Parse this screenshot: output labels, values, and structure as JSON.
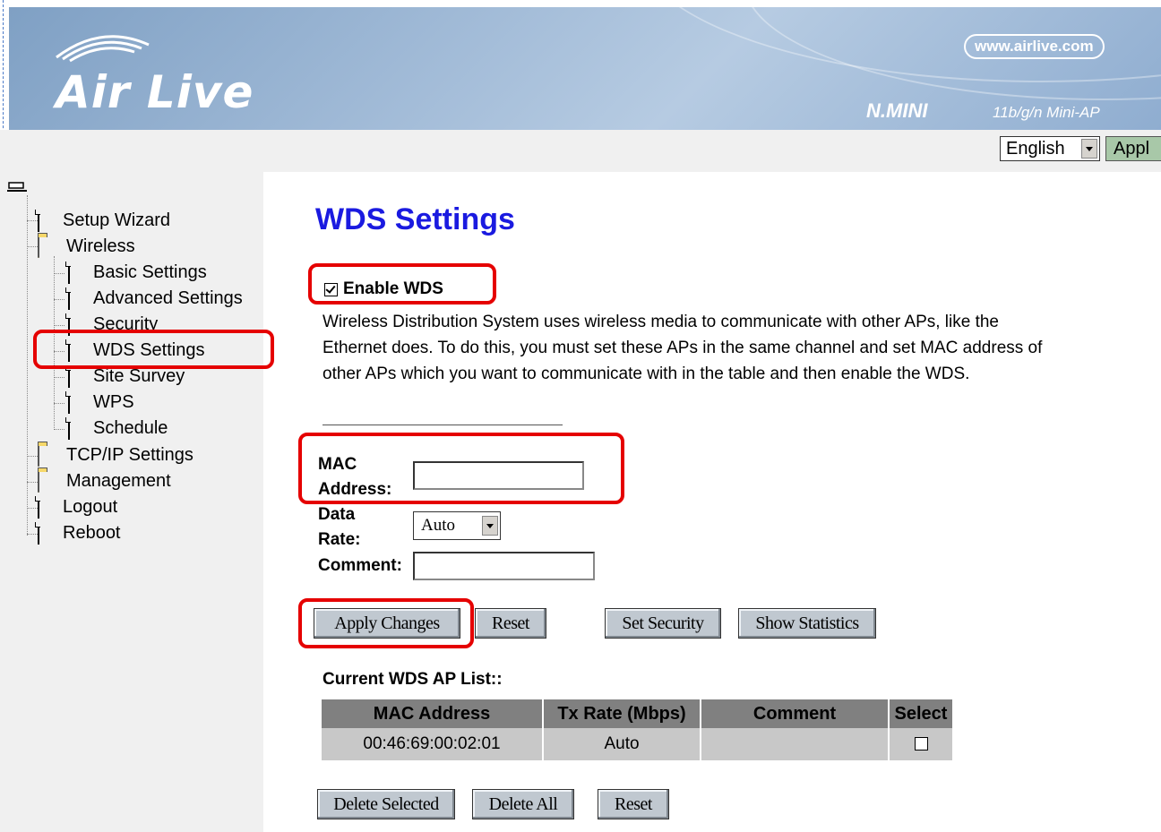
{
  "header": {
    "logo": "Air Live",
    "website": "www.airlive.com",
    "model": "N.MINI",
    "model_desc": "11b/g/n Mini-AP"
  },
  "language_bar": {
    "selected_language": "English",
    "apply_label": "Appl"
  },
  "sidebar": {
    "items": [
      {
        "label": "Setup Wizard",
        "icon": "document-icon"
      },
      {
        "label": "Wireless",
        "icon": "open-folder-icon"
      },
      {
        "label": "Basic Settings",
        "icon": "document-icon"
      },
      {
        "label": "Advanced Settings",
        "icon": "document-icon"
      },
      {
        "label": "Security",
        "icon": "document-icon"
      },
      {
        "label": "WDS Settings",
        "icon": "document-icon"
      },
      {
        "label": "Site Survey",
        "icon": "document-icon"
      },
      {
        "label": "WPS",
        "icon": "document-icon"
      },
      {
        "label": "Schedule",
        "icon": "document-icon"
      },
      {
        "label": "TCP/IP Settings",
        "icon": "folder-icon"
      },
      {
        "label": "Management",
        "icon": "folder-icon"
      },
      {
        "label": "Logout",
        "icon": "document-icon"
      },
      {
        "label": "Reboot",
        "icon": "document-icon"
      }
    ]
  },
  "main": {
    "title": "WDS Settings",
    "enable_wds_label": "Enable WDS",
    "enable_wds_checked": true,
    "description": "Wireless Distribution System uses wireless media to communicate with other APs, like the Ethernet does. To do this, you must set these APs in the same channel and set MAC address of other APs which you want to communicate with in the table and then enable the WDS.",
    "form": {
      "mac_label_1": "MAC",
      "mac_label_2": "Address:",
      "mac_value": "",
      "rate_label_1": "Data",
      "rate_label_2": "Rate:",
      "rate_value": "Auto",
      "comment_label": "Comment:",
      "comment_value": ""
    },
    "buttons": {
      "apply": "Apply Changes",
      "reset": "Reset",
      "set_security": "Set Security",
      "show_statistics": "Show Statistics"
    },
    "list": {
      "title": "Current WDS AP List::",
      "columns": [
        "MAC Address",
        "Tx Rate (Mbps)",
        "Comment",
        "Select"
      ],
      "rows": [
        {
          "mac": "00:46:69:00:02:01",
          "rate": "Auto",
          "comment": "",
          "selected": false
        }
      ]
    },
    "list_buttons": {
      "delete_selected": "Delete Selected",
      "delete_all": "Delete All",
      "reset": "Reset"
    },
    "highlight_color": "#e50000"
  }
}
